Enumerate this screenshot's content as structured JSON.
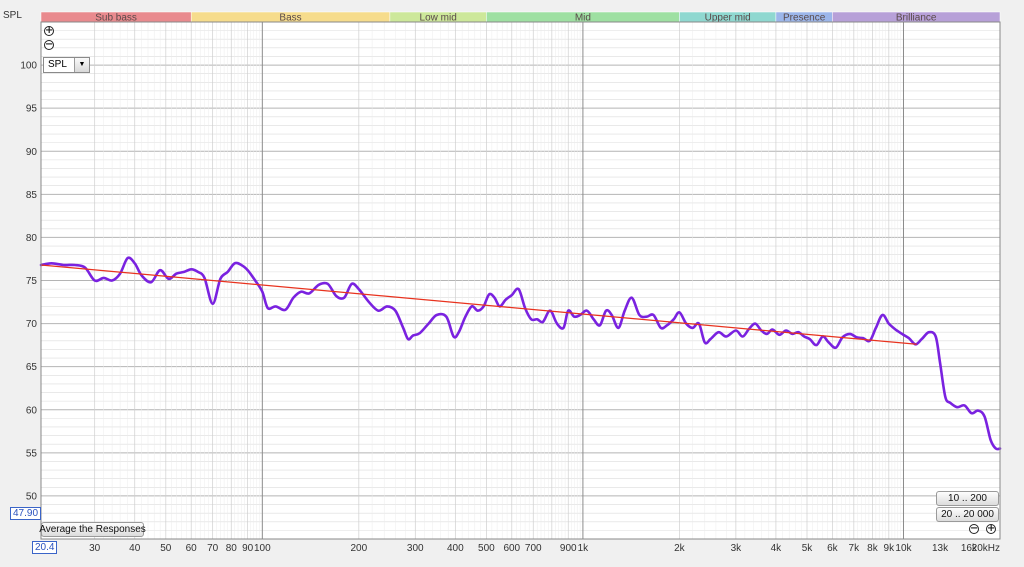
{
  "ylabel": "SPL",
  "display_dropdown": {
    "selected": "SPL"
  },
  "average_button": "Average the Responses",
  "range_buttons": [
    "10 .. 200",
    "20 .. 20 000"
  ],
  "y_min_readout": "47.90",
  "x_min_readout": "20.4",
  "icons": {
    "zoom_in": "plus-circle-icon",
    "zoom_out": "minus-circle-icon",
    "dropdown": "chevron-down-icon"
  },
  "colors": {
    "response": "#7a22e0",
    "trend": "#e8321e",
    "plot_background": "#ffffff",
    "grid_major": "#8c8c8c",
    "grid_minor": "#dcdcdc"
  },
  "bands": [
    {
      "name": "Sub bass",
      "from": 20,
      "to": 60,
      "color": "#e98a8e"
    },
    {
      "name": "Bass",
      "from": 60,
      "to": 250,
      "color": "#f6dc8c"
    },
    {
      "name": "Low mid",
      "from": 250,
      "to": 500,
      "color": "#cde89a"
    },
    {
      "name": "Mid",
      "from": 500,
      "to": 2000,
      "color": "#9ee0a2"
    },
    {
      "name": "Upper mid",
      "from": 2000,
      "to": 4000,
      "color": "#8fd8d0"
    },
    {
      "name": "Presence",
      "from": 4000,
      "to": 6000,
      "color": "#9cb6ea"
    },
    {
      "name": "Brilliance",
      "from": 6000,
      "to": 20000,
      "color": "#b7a0d8"
    }
  ],
  "chart_data": {
    "type": "line",
    "x_scale": "log",
    "xlim": [
      20.4,
      20000
    ],
    "ylim": [
      45,
      105
    ],
    "grid": true,
    "xticks": [
      {
        "v": 30,
        "label": "30"
      },
      {
        "v": 40,
        "label": "40"
      },
      {
        "v": 50,
        "label": "50"
      },
      {
        "v": 60,
        "label": "60"
      },
      {
        "v": 70,
        "label": "70"
      },
      {
        "v": 80,
        "label": "80"
      },
      {
        "v": 90,
        "label": "90"
      },
      {
        "v": 100,
        "label": "100"
      },
      {
        "v": 200,
        "label": "200"
      },
      {
        "v": 300,
        "label": "300"
      },
      {
        "v": 400,
        "label": "400"
      },
      {
        "v": 500,
        "label": "500"
      },
      {
        "v": 600,
        "label": "600"
      },
      {
        "v": 700,
        "label": "700"
      },
      {
        "v": 900,
        "label": "900"
      },
      {
        "v": 1000,
        "label": "1k"
      },
      {
        "v": 2000,
        "label": "2k"
      },
      {
        "v": 3000,
        "label": "3k"
      },
      {
        "v": 4000,
        "label": "4k"
      },
      {
        "v": 5000,
        "label": "5k"
      },
      {
        "v": 6000,
        "label": "6k"
      },
      {
        "v": 7000,
        "label": "7k"
      },
      {
        "v": 8000,
        "label": "8k"
      },
      {
        "v": 9000,
        "label": "9k"
      },
      {
        "v": 10000,
        "label": "10k"
      },
      {
        "v": 13000,
        "label": "13k"
      },
      {
        "v": 16000,
        "label": "16k"
      },
      {
        "v": 20000,
        "label": "20kHz"
      }
    ],
    "yticks": [
      50,
      55,
      60,
      65,
      70,
      75,
      80,
      85,
      90,
      95,
      100
    ],
    "series": [
      {
        "points": [
          [
            20.4,
            76.8
          ],
          [
            22,
            77.0
          ],
          [
            24,
            76.8
          ],
          [
            26,
            76.8
          ],
          [
            28,
            76.5
          ],
          [
            30,
            75.0
          ],
          [
            32,
            75.3
          ],
          [
            34,
            75.0
          ],
          [
            36,
            75.8
          ],
          [
            38,
            77.6
          ],
          [
            40,
            77.0
          ],
          [
            42,
            75.6
          ],
          [
            45,
            74.8
          ],
          [
            48,
            76.2
          ],
          [
            51,
            75.2
          ],
          [
            54,
            75.8
          ],
          [
            57,
            76.0
          ],
          [
            60,
            76.3
          ],
          [
            63,
            76.0
          ],
          [
            66,
            75.3
          ],
          [
            70,
            72.3
          ],
          [
            74,
            75.2
          ],
          [
            78,
            76.0
          ],
          [
            82,
            77.0
          ],
          [
            86,
            76.8
          ],
          [
            90,
            76.2
          ],
          [
            95,
            75.0
          ],
          [
            100,
            73.7
          ],
          [
            104,
            71.8
          ],
          [
            110,
            72.0
          ],
          [
            118,
            71.6
          ],
          [
            125,
            73.0
          ],
          [
            132,
            73.7
          ],
          [
            140,
            73.5
          ],
          [
            150,
            74.5
          ],
          [
            160,
            74.6
          ],
          [
            170,
            73.2
          ],
          [
            180,
            73.0
          ],
          [
            190,
            74.6
          ],
          [
            200,
            74.0
          ],
          [
            215,
            72.5
          ],
          [
            230,
            71.5
          ],
          [
            245,
            72.0
          ],
          [
            260,
            71.5
          ],
          [
            275,
            69.5
          ],
          [
            285,
            68.2
          ],
          [
            295,
            68.6
          ],
          [
            310,
            68.9
          ],
          [
            330,
            70.0
          ],
          [
            350,
            71.0
          ],
          [
            375,
            70.8
          ],
          [
            395,
            68.5
          ],
          [
            410,
            69.0
          ],
          [
            430,
            70.8
          ],
          [
            450,
            72.0
          ],
          [
            470,
            71.5
          ],
          [
            490,
            72.0
          ],
          [
            510,
            73.4
          ],
          [
            530,
            73.0
          ],
          [
            550,
            72.0
          ],
          [
            575,
            72.8
          ],
          [
            600,
            73.3
          ],
          [
            630,
            74.0
          ],
          [
            660,
            71.8
          ],
          [
            690,
            70.5
          ],
          [
            720,
            70.5
          ],
          [
            750,
            70.2
          ],
          [
            790,
            71.5
          ],
          [
            830,
            70.0
          ],
          [
            870,
            69.5
          ],
          [
            900,
            71.5
          ],
          [
            940,
            70.8
          ],
          [
            980,
            71.0
          ],
          [
            1030,
            71.5
          ],
          [
            1080,
            70.5
          ],
          [
            1130,
            69.8
          ],
          [
            1180,
            71.5
          ],
          [
            1230,
            71.0
          ],
          [
            1290,
            69.5
          ],
          [
            1350,
            71.5
          ],
          [
            1420,
            73.0
          ],
          [
            1500,
            71.0
          ],
          [
            1580,
            70.8
          ],
          [
            1660,
            71.0
          ],
          [
            1750,
            69.5
          ],
          [
            1830,
            69.8
          ],
          [
            1920,
            70.5
          ],
          [
            2000,
            71.3
          ],
          [
            2100,
            70.0
          ],
          [
            2200,
            69.5
          ],
          [
            2300,
            70.0
          ],
          [
            2400,
            67.8
          ],
          [
            2500,
            68.2
          ],
          [
            2650,
            69.0
          ],
          [
            2800,
            68.5
          ],
          [
            3000,
            69.2
          ],
          [
            3150,
            68.5
          ],
          [
            3300,
            69.4
          ],
          [
            3450,
            70.0
          ],
          [
            3600,
            69.2
          ],
          [
            3750,
            68.8
          ],
          [
            3900,
            69.3
          ],
          [
            4100,
            68.7
          ],
          [
            4300,
            69.2
          ],
          [
            4500,
            68.8
          ],
          [
            4700,
            69.0
          ],
          [
            4900,
            68.5
          ],
          [
            5100,
            68.2
          ],
          [
            5350,
            67.5
          ],
          [
            5600,
            68.5
          ],
          [
            5850,
            67.8
          ],
          [
            6150,
            67.2
          ],
          [
            6450,
            68.4
          ],
          [
            6800,
            68.8
          ],
          [
            7150,
            68.4
          ],
          [
            7500,
            68.3
          ],
          [
            7850,
            68.0
          ],
          [
            8200,
            69.5
          ],
          [
            8600,
            71.0
          ],
          [
            9000,
            70.0
          ],
          [
            9450,
            69.3
          ],
          [
            9900,
            68.8
          ],
          [
            10400,
            68.3
          ],
          [
            10900,
            67.6
          ],
          [
            11400,
            68.2
          ],
          [
            12000,
            69.0
          ],
          [
            12600,
            68.5
          ],
          [
            13000,
            65.5
          ],
          [
            13500,
            61.5
          ],
          [
            14000,
            60.8
          ],
          [
            14700,
            60.3
          ],
          [
            15500,
            60.5
          ],
          [
            16300,
            59.6
          ],
          [
            17100,
            59.9
          ],
          [
            17900,
            59.2
          ],
          [
            18700,
            56.5
          ],
          [
            19400,
            55.5
          ],
          [
            20000,
            55.5
          ]
        ]
      },
      {
        "points": [
          [
            20.4,
            76.8
          ],
          [
            11000,
            67.6
          ]
        ]
      }
    ]
  }
}
